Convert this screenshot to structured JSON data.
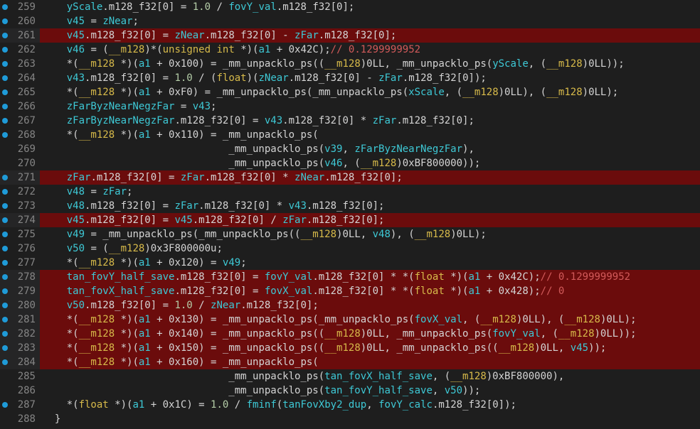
{
  "editor": {
    "colors": {
      "background": "#1e1e1e",
      "highlight": "#6b0c0c",
      "identifier": "#3ec9d6",
      "type": "#d7ba4a",
      "number": "#b5cea8",
      "comment": "#d25a5a",
      "breakpoint": "#1f9bd8",
      "line_number": "#858585"
    },
    "lines": [
      {
        "n": "259",
        "bp": true,
        "hl": false,
        "tokens": [
          {
            "t": "    "
          },
          {
            "t": "yScale",
            "c": "cy"
          },
          {
            "t": ".m128_f32[0] = "
          },
          {
            "t": "1.0",
            "c": "gr"
          },
          {
            "t": " / "
          },
          {
            "t": "fovY_val",
            "c": "cy"
          },
          {
            "t": ".m128_f32[0];"
          }
        ]
      },
      {
        "n": "260",
        "bp": true,
        "hl": false,
        "tokens": [
          {
            "t": "    "
          },
          {
            "t": "v45",
            "c": "cy"
          },
          {
            "t": " = "
          },
          {
            "t": "zNear",
            "c": "cy"
          },
          {
            "t": ";"
          }
        ]
      },
      {
        "n": "261",
        "bp": true,
        "hl": true,
        "tokens": [
          {
            "t": "    "
          },
          {
            "t": "v45",
            "c": "cy"
          },
          {
            "t": ".m128_f32[0] = "
          },
          {
            "t": "zNear",
            "c": "cy"
          },
          {
            "t": ".m128_f32[0] - "
          },
          {
            "t": "zFar",
            "c": "cy"
          },
          {
            "t": ".m128_f32[0];"
          }
        ]
      },
      {
        "n": "262",
        "bp": true,
        "hl": false,
        "tokens": [
          {
            "t": "    "
          },
          {
            "t": "v46",
            "c": "cy"
          },
          {
            "t": " = ("
          },
          {
            "t": "__m128",
            "c": "yl"
          },
          {
            "t": ")*("
          },
          {
            "t": "unsigned int",
            "c": "yl"
          },
          {
            "t": " *)("
          },
          {
            "t": "a1",
            "c": "cy"
          },
          {
            "t": " + 0x42C);"
          },
          {
            "t": "// 0.1299999952",
            "c": "cm"
          }
        ]
      },
      {
        "n": "263",
        "bp": true,
        "hl": false,
        "tokens": [
          {
            "t": "    *("
          },
          {
            "t": "__m128",
            "c": "yl"
          },
          {
            "t": " *)("
          },
          {
            "t": "a1",
            "c": "cy"
          },
          {
            "t": " + 0x100) = _mm_unpacklo_ps(("
          },
          {
            "t": "__m128",
            "c": "yl"
          },
          {
            "t": ")0LL, _mm_unpacklo_ps("
          },
          {
            "t": "yScale",
            "c": "cy"
          },
          {
            "t": ", ("
          },
          {
            "t": "__m128",
            "c": "yl"
          },
          {
            "t": ")0LL));"
          }
        ]
      },
      {
        "n": "264",
        "bp": true,
        "hl": false,
        "tokens": [
          {
            "t": "    "
          },
          {
            "t": "v43",
            "c": "cy"
          },
          {
            "t": ".m128_f32[0] = "
          },
          {
            "t": "1.0",
            "c": "gr"
          },
          {
            "t": " / ("
          },
          {
            "t": "float",
            "c": "yl"
          },
          {
            "t": ")("
          },
          {
            "t": "zNear",
            "c": "cy"
          },
          {
            "t": ".m128_f32[0] - "
          },
          {
            "t": "zFar",
            "c": "cy"
          },
          {
            "t": ".m128_f32[0]);"
          }
        ]
      },
      {
        "n": "265",
        "bp": true,
        "hl": false,
        "tokens": [
          {
            "t": "    *("
          },
          {
            "t": "__m128",
            "c": "yl"
          },
          {
            "t": " *)("
          },
          {
            "t": "a1",
            "c": "cy"
          },
          {
            "t": " + 0xF0) = _mm_unpacklo_ps(_mm_unpacklo_ps("
          },
          {
            "t": "xScale",
            "c": "cy"
          },
          {
            "t": ", ("
          },
          {
            "t": "__m128",
            "c": "yl"
          },
          {
            "t": ")0LL), ("
          },
          {
            "t": "__m128",
            "c": "yl"
          },
          {
            "t": ")0LL);"
          }
        ]
      },
      {
        "n": "266",
        "bp": true,
        "hl": false,
        "tokens": [
          {
            "t": "    "
          },
          {
            "t": "zFarByzNearNegzFar",
            "c": "cy"
          },
          {
            "t": " = "
          },
          {
            "t": "v43",
            "c": "cy"
          },
          {
            "t": ";"
          }
        ]
      },
      {
        "n": "267",
        "bp": true,
        "hl": false,
        "tokens": [
          {
            "t": "    "
          },
          {
            "t": "zFarByzNearNegzFar",
            "c": "cy"
          },
          {
            "t": ".m128_f32[0] = "
          },
          {
            "t": "v43",
            "c": "cy"
          },
          {
            "t": ".m128_f32[0] * "
          },
          {
            "t": "zFar",
            "c": "cy"
          },
          {
            "t": ".m128_f32[0];"
          }
        ]
      },
      {
        "n": "268",
        "bp": true,
        "hl": false,
        "tokens": [
          {
            "t": "    *("
          },
          {
            "t": "__m128",
            "c": "yl"
          },
          {
            "t": " *)("
          },
          {
            "t": "a1",
            "c": "cy"
          },
          {
            "t": " + 0x110) = _mm_unpacklo_ps("
          }
        ]
      },
      {
        "n": "269",
        "bp": false,
        "hl": false,
        "tokens": [
          {
            "t": "                               _mm_unpacklo_ps("
          },
          {
            "t": "v39",
            "c": "cy"
          },
          {
            "t": ", "
          },
          {
            "t": "zFarByzNearNegzFar",
            "c": "cy"
          },
          {
            "t": "),"
          }
        ]
      },
      {
        "n": "270",
        "bp": false,
        "hl": false,
        "tokens": [
          {
            "t": "                               _mm_unpacklo_ps("
          },
          {
            "t": "v46",
            "c": "cy"
          },
          {
            "t": ", ("
          },
          {
            "t": "__m128",
            "c": "yl"
          },
          {
            "t": ")0xBF800000));"
          }
        ]
      },
      {
        "n": "271",
        "bp": true,
        "hl": true,
        "tokens": [
          {
            "t": "    "
          },
          {
            "t": "zFar",
            "c": "cy"
          },
          {
            "t": ".m128_f32[0] = "
          },
          {
            "t": "zFar",
            "c": "cy"
          },
          {
            "t": ".m128_f32[0] * "
          },
          {
            "t": "zNear",
            "c": "cy"
          },
          {
            "t": ".m128_f32[0];"
          }
        ]
      },
      {
        "n": "272",
        "bp": true,
        "hl": false,
        "tokens": [
          {
            "t": "    "
          },
          {
            "t": "v48",
            "c": "cy"
          },
          {
            "t": " = "
          },
          {
            "t": "zFar",
            "c": "cy"
          },
          {
            "t": ";"
          }
        ]
      },
      {
        "n": "273",
        "bp": true,
        "hl": false,
        "tokens": [
          {
            "t": "    "
          },
          {
            "t": "v48",
            "c": "cy"
          },
          {
            "t": ".m128_f32[0] = "
          },
          {
            "t": "zFar",
            "c": "cy"
          },
          {
            "t": ".m128_f32[0] * "
          },
          {
            "t": "v43",
            "c": "cy"
          },
          {
            "t": ".m128_f32[0];"
          }
        ]
      },
      {
        "n": "274",
        "bp": true,
        "hl": true,
        "tokens": [
          {
            "t": "    "
          },
          {
            "t": "v45",
            "c": "cy"
          },
          {
            "t": ".m128_f32[0] = "
          },
          {
            "t": "v45",
            "c": "cy"
          },
          {
            "t": ".m128_f32[0] / "
          },
          {
            "t": "zFar",
            "c": "cy"
          },
          {
            "t": ".m128_f32[0];"
          }
        ]
      },
      {
        "n": "275",
        "bp": true,
        "hl": false,
        "tokens": [
          {
            "t": "    "
          },
          {
            "t": "v49",
            "c": "cy"
          },
          {
            "t": " = _mm_unpacklo_ps(_mm_unpacklo_ps(("
          },
          {
            "t": "__m128",
            "c": "yl"
          },
          {
            "t": ")0LL, "
          },
          {
            "t": "v48",
            "c": "cy"
          },
          {
            "t": "), ("
          },
          {
            "t": "__m128",
            "c": "yl"
          },
          {
            "t": ")0LL);"
          }
        ]
      },
      {
        "n": "276",
        "bp": true,
        "hl": false,
        "tokens": [
          {
            "t": "    "
          },
          {
            "t": "v50",
            "c": "cy"
          },
          {
            "t": " = ("
          },
          {
            "t": "__m128",
            "c": "yl"
          },
          {
            "t": ")0x3F800000u;"
          }
        ]
      },
      {
        "n": "277",
        "bp": true,
        "hl": false,
        "tokens": [
          {
            "t": "    *("
          },
          {
            "t": "__m128",
            "c": "yl"
          },
          {
            "t": " *)("
          },
          {
            "t": "a1",
            "c": "cy"
          },
          {
            "t": " + 0x120) = "
          },
          {
            "t": "v49",
            "c": "cy"
          },
          {
            "t": ";"
          }
        ]
      },
      {
        "n": "278",
        "bp": true,
        "hl": true,
        "tokens": [
          {
            "t": "    "
          },
          {
            "t": "tan_fovY_half_save",
            "c": "cy"
          },
          {
            "t": ".m128_f32[0] = "
          },
          {
            "t": "fovY_val",
            "c": "cy"
          },
          {
            "t": ".m128_f32[0] * *("
          },
          {
            "t": "float",
            "c": "yl"
          },
          {
            "t": " *)("
          },
          {
            "t": "a1",
            "c": "cy"
          },
          {
            "t": " + 0x42C);"
          },
          {
            "t": "// 0.1299999952",
            "c": "cm"
          }
        ]
      },
      {
        "n": "279",
        "bp": true,
        "hl": true,
        "tokens": [
          {
            "t": "    "
          },
          {
            "t": "tan_fovX_half_save",
            "c": "cy"
          },
          {
            "t": ".m128_f32[0] = "
          },
          {
            "t": "fovX_val",
            "c": "cy"
          },
          {
            "t": ".m128_f32[0] * *("
          },
          {
            "t": "float",
            "c": "yl"
          },
          {
            "t": " *)("
          },
          {
            "t": "a1",
            "c": "cy"
          },
          {
            "t": " + 0x428);"
          },
          {
            "t": "// 0",
            "c": "cm"
          }
        ]
      },
      {
        "n": "280",
        "bp": true,
        "hl": true,
        "tokens": [
          {
            "t": "    "
          },
          {
            "t": "v50",
            "c": "cy"
          },
          {
            "t": ".m128_f32[0] = "
          },
          {
            "t": "1.0",
            "c": "gr"
          },
          {
            "t": " / "
          },
          {
            "t": "zNear",
            "c": "cy"
          },
          {
            "t": ".m128_f32[0];"
          }
        ]
      },
      {
        "n": "281",
        "bp": true,
        "hl": true,
        "tokens": [
          {
            "t": "    *("
          },
          {
            "t": "__m128",
            "c": "yl"
          },
          {
            "t": " *)("
          },
          {
            "t": "a1",
            "c": "cy"
          },
          {
            "t": " + 0x130) = _mm_unpacklo_ps(_mm_unpacklo_ps("
          },
          {
            "t": "fovX_val",
            "c": "cy"
          },
          {
            "t": ", ("
          },
          {
            "t": "__m128",
            "c": "yl"
          },
          {
            "t": ")0LL), ("
          },
          {
            "t": "__m128",
            "c": "yl"
          },
          {
            "t": ")0LL);"
          }
        ]
      },
      {
        "n": "282",
        "bp": true,
        "hl": true,
        "tokens": [
          {
            "t": "    *("
          },
          {
            "t": "__m128",
            "c": "yl"
          },
          {
            "t": " *)("
          },
          {
            "t": "a1",
            "c": "cy"
          },
          {
            "t": " + 0x140) = _mm_unpacklo_ps(("
          },
          {
            "t": "__m128",
            "c": "yl"
          },
          {
            "t": ")0LL, _mm_unpacklo_ps("
          },
          {
            "t": "fovY_val",
            "c": "cy"
          },
          {
            "t": ", ("
          },
          {
            "t": "__m128",
            "c": "yl"
          },
          {
            "t": ")0LL));"
          }
        ]
      },
      {
        "n": "283",
        "bp": true,
        "hl": true,
        "tokens": [
          {
            "t": "    *("
          },
          {
            "t": "__m128",
            "c": "yl"
          },
          {
            "t": " *)("
          },
          {
            "t": "a1",
            "c": "cy"
          },
          {
            "t": " + 0x150) = _mm_unpacklo_ps(("
          },
          {
            "t": "__m128",
            "c": "yl"
          },
          {
            "t": ")0LL, _mm_unpacklo_ps(("
          },
          {
            "t": "__m128",
            "c": "yl"
          },
          {
            "t": ")0LL, "
          },
          {
            "t": "v45",
            "c": "cy"
          },
          {
            "t": "));"
          }
        ]
      },
      {
        "n": "284",
        "bp": true,
        "hl": true,
        "tokens": [
          {
            "t": "    *("
          },
          {
            "t": "__m128",
            "c": "yl"
          },
          {
            "t": " *)("
          },
          {
            "t": "a1",
            "c": "cy"
          },
          {
            "t": " + 0x160) = _mm_unpacklo_ps("
          }
        ]
      },
      {
        "n": "285",
        "bp": false,
        "hl": false,
        "tokens": [
          {
            "t": "                               _mm_unpacklo_ps("
          },
          {
            "t": "tan_fovX_half_save",
            "c": "cy"
          },
          {
            "t": ", ("
          },
          {
            "t": "__m128",
            "c": "yl"
          },
          {
            "t": ")0xBF800000),"
          }
        ]
      },
      {
        "n": "286",
        "bp": false,
        "hl": false,
        "tokens": [
          {
            "t": "                               _mm_unpacklo_ps("
          },
          {
            "t": "tan_fovY_half_save",
            "c": "cy"
          },
          {
            "t": ", "
          },
          {
            "t": "v50",
            "c": "cy"
          },
          {
            "t": "));"
          }
        ]
      },
      {
        "n": "287",
        "bp": true,
        "hl": false,
        "tokens": [
          {
            "t": "    *("
          },
          {
            "t": "float",
            "c": "yl"
          },
          {
            "t": " *)("
          },
          {
            "t": "a1",
            "c": "cy"
          },
          {
            "t": " + 0x1C) = "
          },
          {
            "t": "1.0",
            "c": "gr"
          },
          {
            "t": " / "
          },
          {
            "t": "fminf",
            "c": "cy"
          },
          {
            "t": "("
          },
          {
            "t": "tanFovXby2_dup",
            "c": "cy"
          },
          {
            "t": ", "
          },
          {
            "t": "fovY_calc",
            "c": "cy"
          },
          {
            "t": ".m128_f32[0]);"
          }
        ]
      },
      {
        "n": "288",
        "bp": false,
        "hl": false,
        "tokens": [
          {
            "t": "  }"
          }
        ]
      }
    ]
  }
}
